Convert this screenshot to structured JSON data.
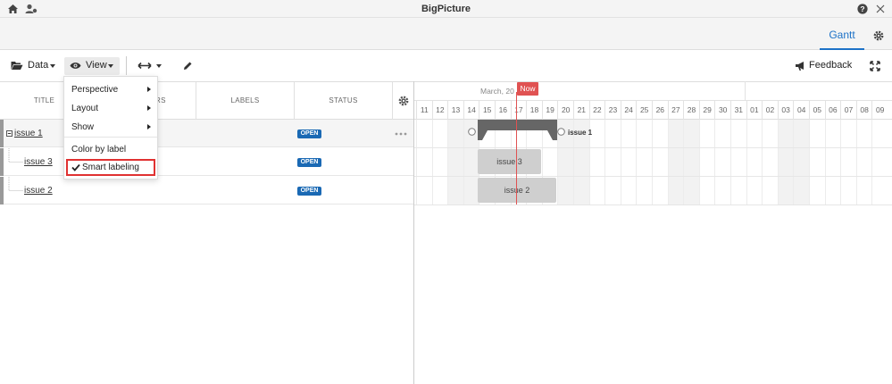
{
  "app": {
    "title": "BigPicture"
  },
  "tabs": {
    "gantt": "Gantt"
  },
  "toolbar": {
    "data_label": "Data",
    "view_label": "View",
    "feedback_label": "Feedback"
  },
  "columns": {
    "title": "TITLE",
    "assignee_partial": "RS",
    "labels": "LABELS",
    "status": "STATUS"
  },
  "tasks": [
    {
      "name": "issue 1",
      "status": "OPEN"
    },
    {
      "name": "issue 3",
      "status": "OPEN"
    },
    {
      "name": "issue 2",
      "status": "OPEN"
    }
  ],
  "timeline": {
    "month_label": "March, 20",
    "now_label": "Now",
    "days": [
      "11",
      "12",
      "13",
      "14",
      "15",
      "16",
      "17",
      "18",
      "19",
      "20",
      "21",
      "22",
      "23",
      "24",
      "25",
      "26",
      "27",
      "28",
      "29",
      "30",
      "31",
      "01",
      "02",
      "03",
      "04",
      "05",
      "06",
      "07",
      "08",
      "09"
    ],
    "weekend_days": [
      "13",
      "14",
      "20",
      "21",
      "27",
      "28",
      "03",
      "04"
    ],
    "summary_label": "issue 1",
    "bars": [
      {
        "label": "issue 3"
      },
      {
        "label": "issue 2"
      }
    ]
  },
  "view_menu": {
    "items": [
      {
        "label": "Perspective",
        "submenu": true
      },
      {
        "label": "Layout",
        "submenu": true
      },
      {
        "label": "Show",
        "submenu": true
      },
      {
        "label": "Color by label",
        "submenu": false
      },
      {
        "label": "Smart labeling",
        "submenu": false,
        "checked": true
      }
    ]
  },
  "colors": {
    "accent": "#1d72c7",
    "badge": "#1a69b4",
    "now_line": "#e05252",
    "highlight": "#e03131"
  },
  "icons": [
    "home-icon",
    "user-settings-icon",
    "help-icon",
    "close-icon",
    "gear-icon",
    "folder-open-icon",
    "eye-icon",
    "expand-horizontal-icon",
    "pencil-icon",
    "megaphone-icon",
    "fullscreen-icon",
    "check-icon",
    "more-dots-icon",
    "collapse-icon",
    "row-settings-icon"
  ]
}
